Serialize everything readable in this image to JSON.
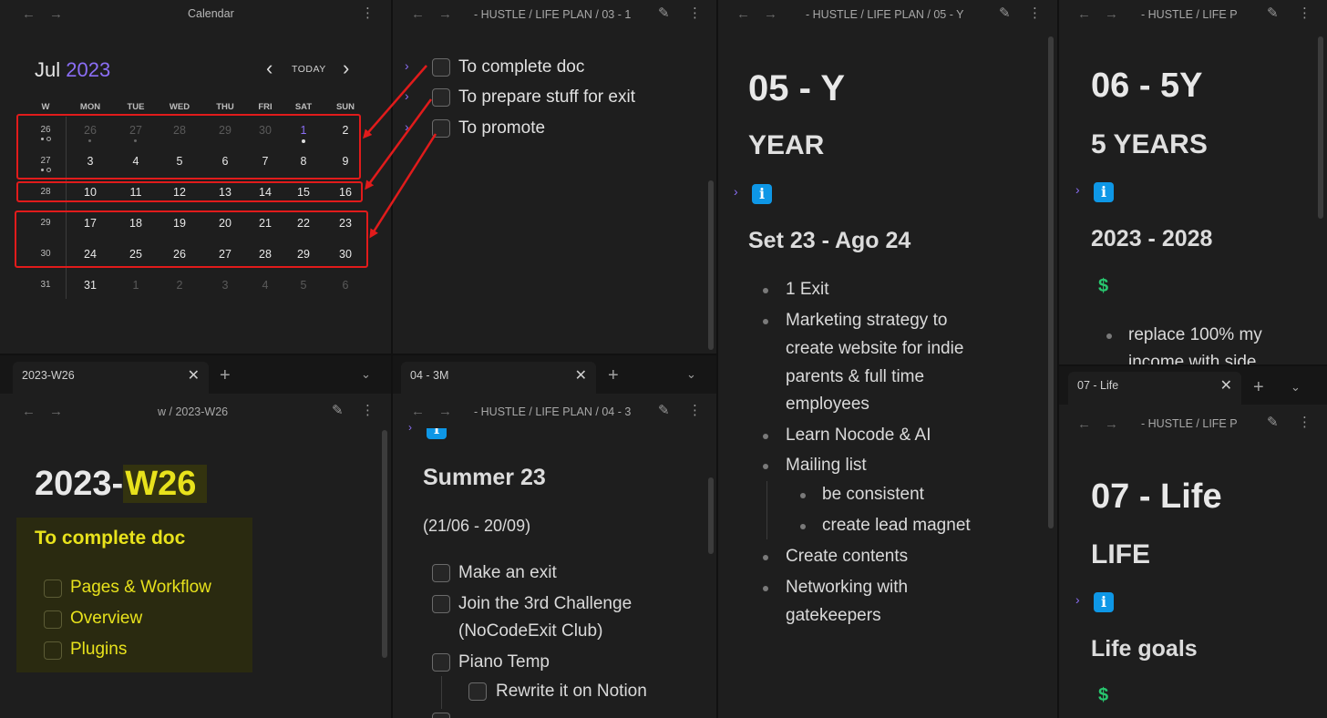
{
  "calendar": {
    "title": "Calendar",
    "month": "Jul",
    "year": "2023",
    "today_label": "TODAY",
    "day_headers": [
      "W",
      "MON",
      "TUE",
      "WED",
      "THU",
      "FRI",
      "SAT",
      "SUN"
    ],
    "weeks": [
      {
        "num": "26",
        "days": [
          "26",
          "27",
          "28",
          "29",
          "30",
          "1",
          "2"
        ]
      },
      {
        "num": "27",
        "days": [
          "3",
          "4",
          "5",
          "6",
          "7",
          "8",
          "9"
        ]
      },
      {
        "num": "28",
        "days": [
          "10",
          "11",
          "12",
          "13",
          "14",
          "15",
          "16"
        ]
      },
      {
        "num": "29",
        "days": [
          "17",
          "18",
          "19",
          "20",
          "21",
          "22",
          "23"
        ]
      },
      {
        "num": "30",
        "days": [
          "24",
          "25",
          "26",
          "27",
          "28",
          "29",
          "30"
        ]
      },
      {
        "num": "31",
        "days": [
          "31",
          "1",
          "2",
          "3",
          "4",
          "5",
          "6"
        ]
      }
    ]
  },
  "pane_todo": {
    "breadcrumb": "- HUSTLE / LIFE PLAN / 03 - 1",
    "items": [
      "To complete doc",
      "To prepare stuff for exit",
      "To promote"
    ]
  },
  "pane_year": {
    "breadcrumb": "- HUSTLE / LIFE PLAN / 05 - Y",
    "h1": "05 - Y",
    "h2": "YEAR",
    "info": "i",
    "h3": "Set 23 - Ago 24",
    "bullets": [
      "1 Exit",
      "Marketing strategy to",
      "create website for indie",
      "parents & full time",
      "employees",
      "Learn Nocode & AI",
      "Mailing list",
      "be consistent",
      "create lead magnet",
      "Create contents",
      "Networking with",
      "gatekeepers"
    ]
  },
  "pane_5y": {
    "breadcrumb": "- HUSTLE / LIFE P",
    "h1": "06 - 5Y",
    "h2": "5 YEARS",
    "info": "i",
    "h3": "2023 - 2028",
    "dollar": "$",
    "bullet_lines": [
      "replace 100% my",
      "income with side"
    ]
  },
  "pane_life": {
    "tab": "07 - Life",
    "breadcrumb": "- HUSTLE / LIFE P",
    "h1": "07 - Life",
    "h2": "LIFE",
    "info": "i",
    "h3": "Life goals",
    "dollar": "$"
  },
  "pane_week": {
    "tab": "2023-W26",
    "breadcrumb": "w / 2023-W26",
    "title_pre": "2023-",
    "title_hl": "W26",
    "callout_title": "To complete doc",
    "items": [
      "Pages & Workflow",
      "Overview",
      "Plugins"
    ]
  },
  "pane_3m": {
    "tab": "04 - 3M",
    "breadcrumb": "- HUSTLE / LIFE PLAN / 04 - 3",
    "info": "i",
    "h2": "Summer 23",
    "dates": "(21/06 - 20/09)",
    "items": [
      "Make an exit",
      "Join the 3rd Challenge",
      "(NoCodeExit Club)",
      "Piano Temp",
      "Rewrite it on Notion"
    ]
  },
  "icons": {
    "back": "←",
    "forward": "→",
    "more": "⋮",
    "edit": "✎",
    "close": "✕",
    "plus": "+",
    "chevron_down": "⌄",
    "chevron_left": "‹",
    "chevron_right": "›",
    "caret": "›"
  },
  "colors": {
    "accent": "#8b6ef5",
    "highlight": "#e8e21c",
    "callout_bg": "#2a2a10",
    "info_blue": "#0e97e6",
    "dollar_green": "#28c76f",
    "annotation_red": "#e11b1b"
  }
}
